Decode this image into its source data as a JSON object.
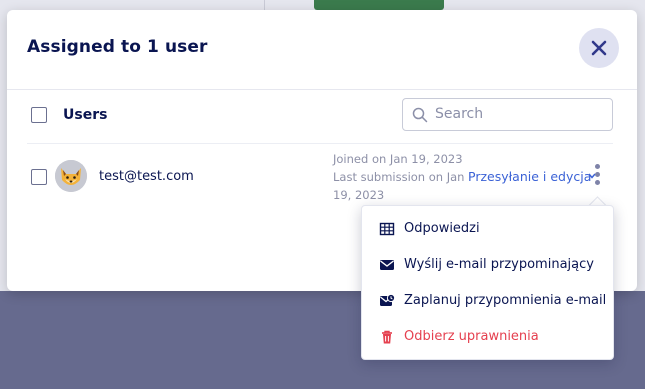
{
  "modal": {
    "title": "Assigned to 1 user",
    "close_icon": "close-icon"
  },
  "table": {
    "header_label": "Users",
    "search": {
      "placeholder": "Search",
      "value": ""
    }
  },
  "users": [
    {
      "email": "test@test.com",
      "avatar_icon": "fox-avatar",
      "joined": "Joined on Jan 19, 2023",
      "last_submission_line1": "Last submission on Jan",
      "last_submission_line2": "19, 2023",
      "permission": "Przesyłanie i edycja"
    }
  ],
  "menu": {
    "items": [
      {
        "label": "Odpowiedzi",
        "icon": "table-icon",
        "danger": false
      },
      {
        "label": "Wyślij e-mail przypominający",
        "icon": "envelope-icon",
        "danger": false
      },
      {
        "label": "Zaplanuj przypomnienia e-mail",
        "icon": "scheduled-mail-icon",
        "danger": false
      },
      {
        "label": "Odbierz uprawnienia",
        "icon": "trash-icon",
        "danger": true
      }
    ]
  },
  "colors": {
    "overlay": "#666a8e",
    "title": "#0a1551",
    "link": "#3b62d6",
    "danger": "#e5404f"
  }
}
